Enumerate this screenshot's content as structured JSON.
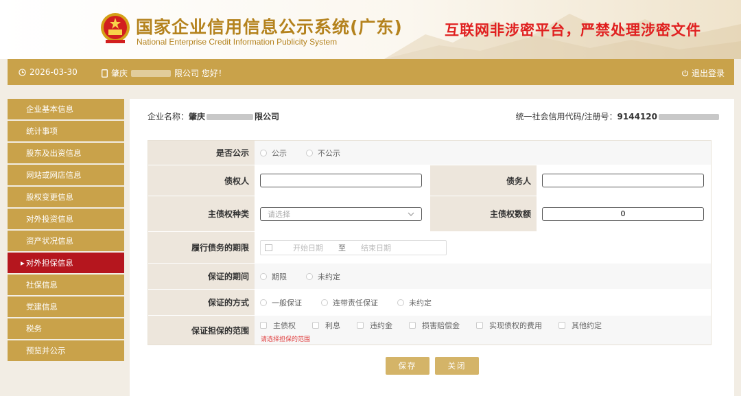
{
  "header": {
    "title_cn": "国家企业信用信息公示系统(广东)",
    "title_en": "National Enterprise Credit Information Publicity System",
    "warning": "互联网非涉密平台，严禁处理涉密文件"
  },
  "topbar": {
    "date": "2026-03-30",
    "greeting_prefix": "肇庆",
    "greeting_suffix": "限公司 您好！",
    "logout": "退出登录"
  },
  "sidebar": {
    "items": [
      "企业基本信息",
      "统计事项",
      "股东及出资信息",
      "网站或网店信息",
      "股权变更信息",
      "对外投资信息",
      "资产状况信息",
      "对外担保信息",
      "社保信息",
      "党建信息",
      "税务",
      "预览并公示"
    ],
    "active_index": 7
  },
  "main": {
    "company_label": "企业名称：",
    "company_prefix": "肇庆",
    "company_suffix": "限公司",
    "credit_label": "统一社会信用代码/注册号：",
    "credit_prefix": "9144120",
    "form": {
      "publicity": {
        "label": "是否公示",
        "options": [
          "公示",
          "不公示"
        ]
      },
      "creditor": {
        "label": "债权人",
        "value": ""
      },
      "debtor": {
        "label": "债务人",
        "value": ""
      },
      "main_claim_type": {
        "label": "主债权种类",
        "placeholder": "请选择"
      },
      "main_claim_amount": {
        "label": "主债权数额",
        "value": "0"
      },
      "performance_period": {
        "label": "履行债务的期限",
        "start_placeholder": "开始日期",
        "separator": "至",
        "end_placeholder": "结束日期"
      },
      "guarantee_period": {
        "label": "保证的期间",
        "options": [
          "期限",
          "未约定"
        ]
      },
      "guarantee_method": {
        "label": "保证的方式",
        "options": [
          "一般保证",
          "连带责任保证",
          "未约定"
        ]
      },
      "guarantee_scope": {
        "label": "保证担保的范围",
        "options": [
          "主债权",
          "利息",
          "违约金",
          "损害赔偿金",
          "实现债权的费用",
          "其他约定"
        ],
        "error": "请选择担保的范围"
      }
    },
    "buttons": {
      "save": "保存",
      "close": "关闭"
    }
  },
  "colors": {
    "gold": "#c9a24a",
    "active_red": "#b5161e",
    "warning_red": "#e02020",
    "label_bg": "#ede6dc"
  }
}
